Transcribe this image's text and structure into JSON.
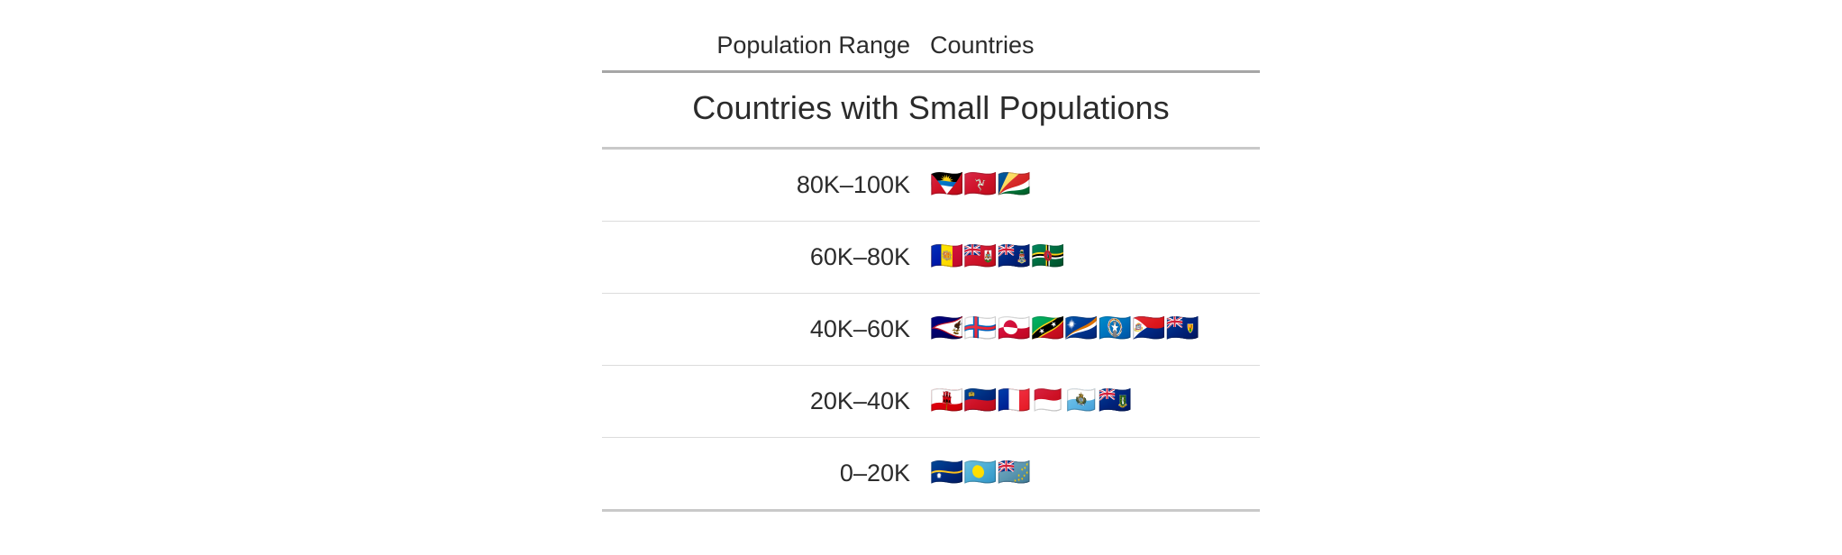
{
  "table": {
    "title": "Countries with Small Populations",
    "columns": [
      {
        "key": "range",
        "label": "Population Range"
      },
      {
        "key": "countries",
        "label": "Countries"
      }
    ],
    "rows": [
      {
        "range": "80K–100K",
        "flags": "🇦🇬🇮🇲🇸🇨",
        "country_names": [
          "Antigua & Barbuda",
          "Isle of Man",
          "Seychelles"
        ],
        "count": 3
      },
      {
        "range": "60K–80K",
        "flags": "🇦🇩🇧🇲🇰🇾🇩🇲",
        "country_names": [
          "Andorra",
          "Bermuda",
          "Cayman Islands",
          "Dominica"
        ],
        "count": 4
      },
      {
        "range": "40K–60K",
        "flags": "🇦🇸🇫🇴🇬🇱🇰🇳🇲🇭🇲🇵🇸🇽🇹🇨",
        "country_names": [
          "American Samoa",
          "Faroe Islands",
          "Greenland",
          "St. Kitts & Nevis",
          "Marshall Islands",
          "Northern Mariana Islands",
          "Sint Maarten",
          "Turks & Caicos Islands"
        ],
        "count": 8
      },
      {
        "range": "20K–40K",
        "flags": "🇬🇮🇱🇮🇲🇫🇲🇨🇸🇲🇻🇬",
        "country_names": [
          "Gibraltar",
          "Liechtenstein",
          "St. Martin",
          "Monaco",
          "San Marino",
          "British Virgin Islands"
        ],
        "count": 6
      },
      {
        "range": "0–20K",
        "flags": "🇳🇷🇵🇼🇹🇻",
        "country_names": [
          "Nauru",
          "Palau",
          "Tuvalu"
        ],
        "count": 3
      }
    ]
  },
  "colors": {
    "background": "#ffffff",
    "text": "#2b2b2b",
    "rule_heavy": "#a6a6a6",
    "rule_medium": "#c9c9c9",
    "rule_light": "#dcdcdc"
  }
}
